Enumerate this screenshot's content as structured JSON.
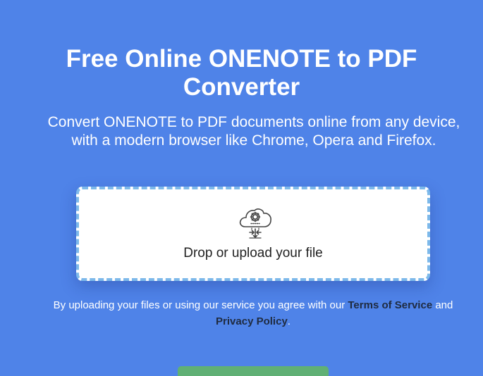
{
  "header": {
    "title_line1": "Free Online ONENOTE to PDF",
    "title_line2": "Converter",
    "subtitle": "Convert ONENOTE to PDF documents online from any device, with a modern browser like Chrome, Opera and Firefox."
  },
  "dropzone": {
    "label": "Drop or upload your file",
    "icon": "cloud-gear-upload-icon"
  },
  "terms": {
    "prefix": "By uploading your files or using our service you agree with our",
    "terms_link": "Terms of Service",
    "conjunction": "and",
    "privacy_link": "Privacy Policy",
    "suffix": "."
  },
  "colors": {
    "background": "#4f83e8",
    "dropzone_border": "#7db9ea",
    "button": "#60b075",
    "link": "#1f2b40"
  }
}
